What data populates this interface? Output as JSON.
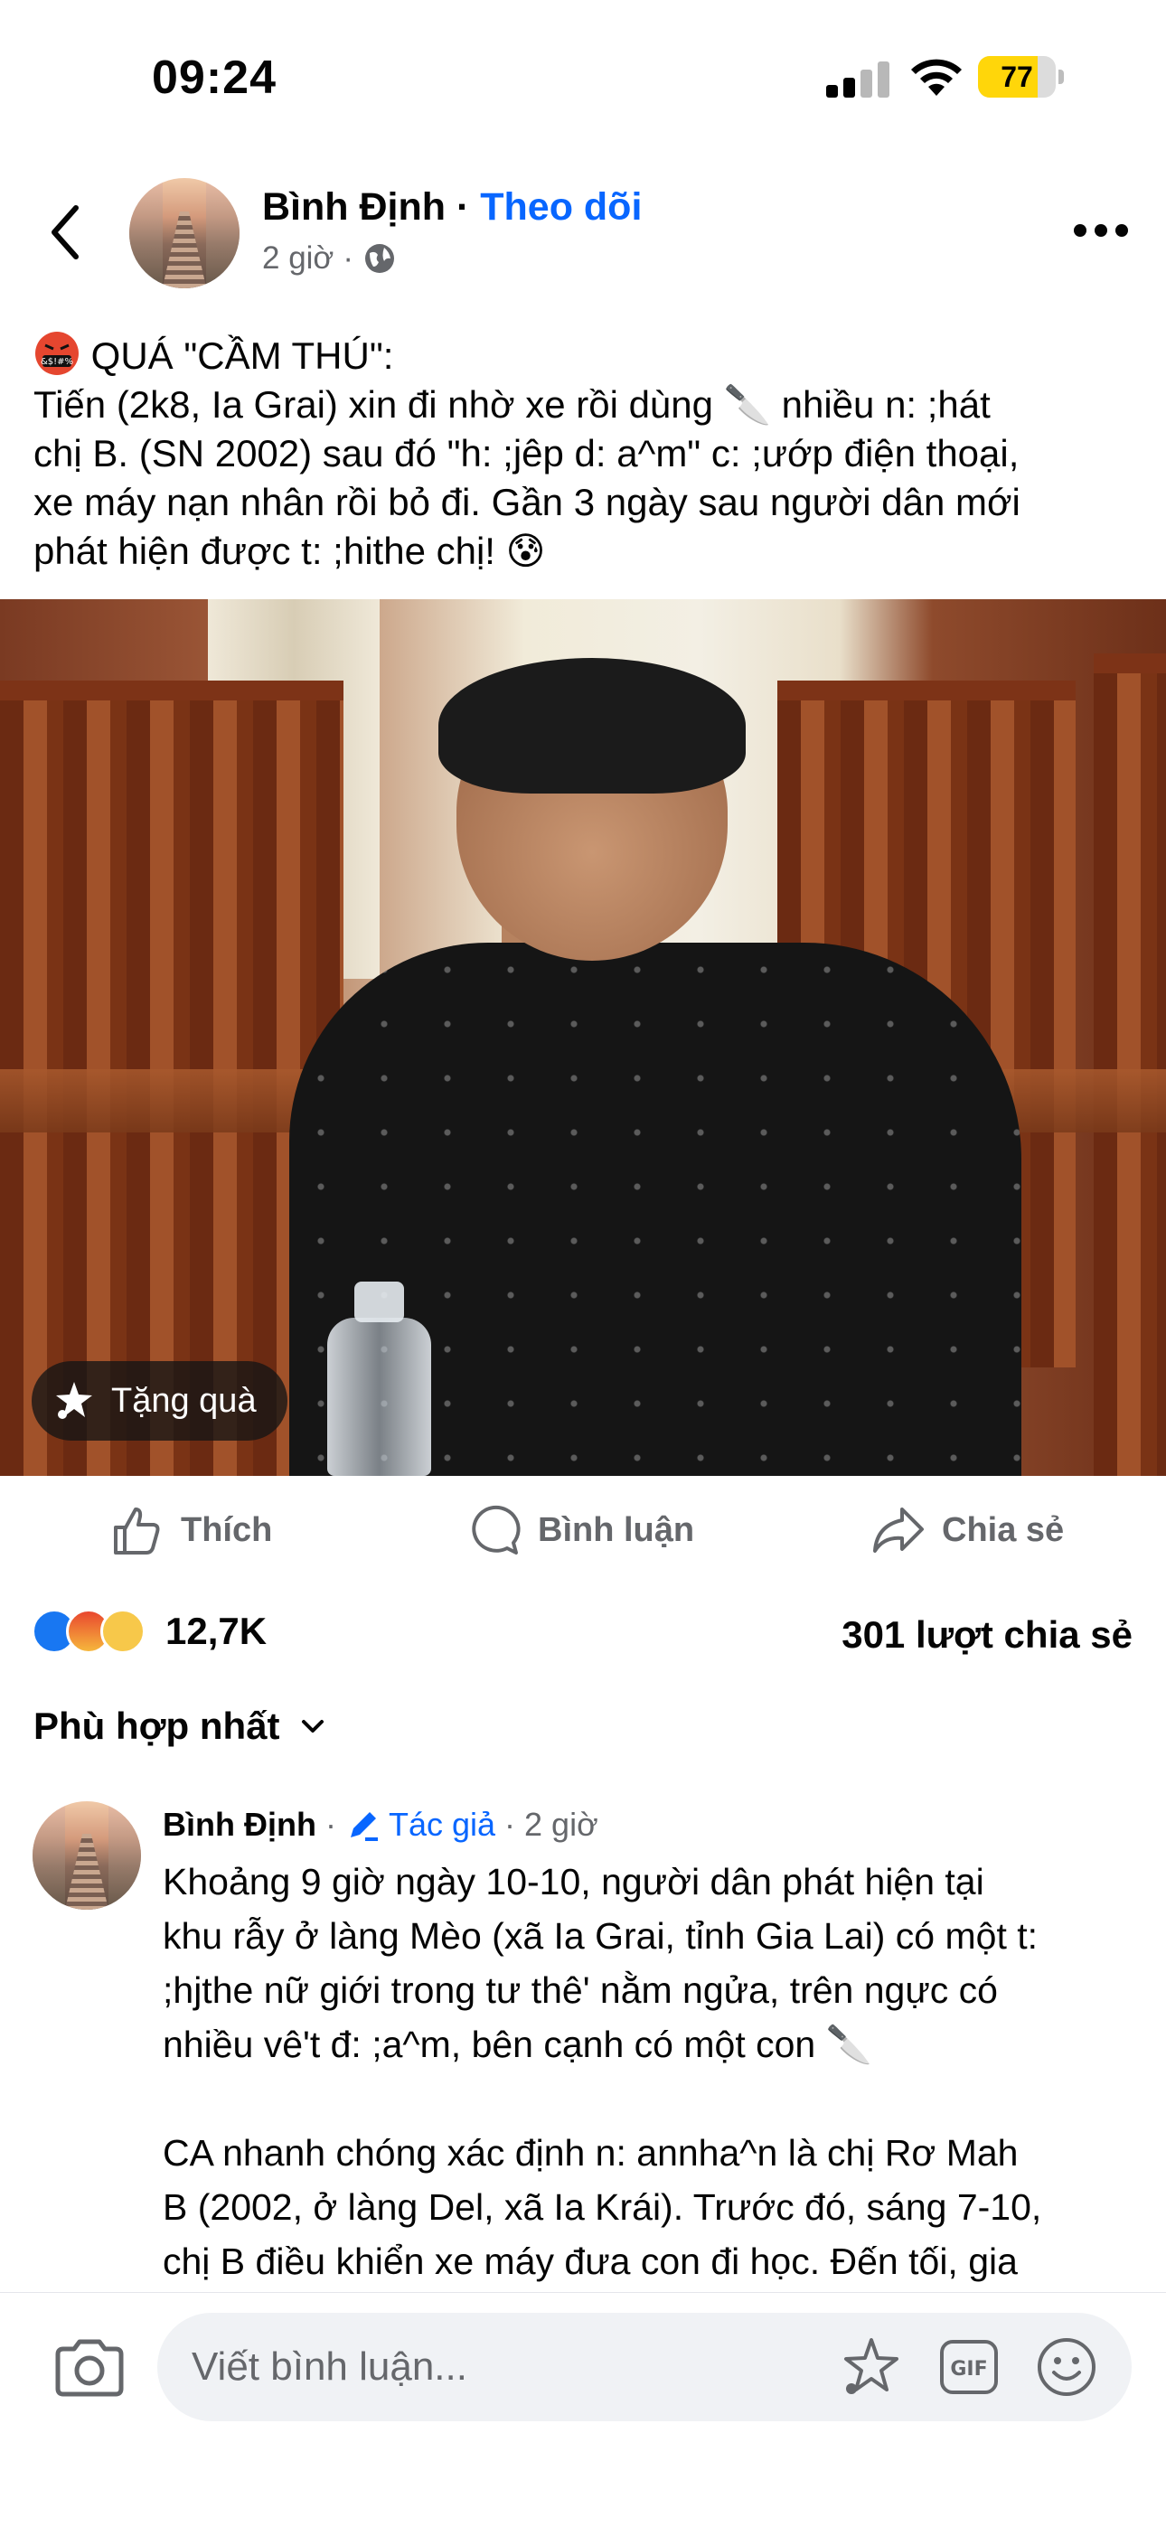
{
  "status_bar": {
    "time": "09:24",
    "battery": "77",
    "battery_level": 0.77,
    "battery_color": "#ffd60a"
  },
  "post": {
    "page_name": "Bình Định",
    "separator": "·",
    "follow_label": "Theo dõi",
    "time": "2 giờ",
    "meta_dot": "·",
    "audience_icon": "globe-icon",
    "caption_lines": [
      "QUÁ \"CẦM THÚ\":",
      "Tiến (2k8, Ia Grai) xin đi nhờ xe rồi dùng 🔪 nhiều n: ;hát",
      "chị B. (SN 2002) sau đó \"h: ;jêp d: a^m\" c: ;ướp điện thoại,",
      "xe máy nạn nhân rồi bỏ đi. Gần 3 ngày sau người dân mới",
      "phát hiện được t: ;hithe chị! 😰"
    ],
    "gift_label": "Tặng quà"
  },
  "actions": {
    "like_label": "Thích",
    "comment_label": "Bình luận",
    "share_label": "Chia sẻ"
  },
  "stats": {
    "reaction_count": "12,7K",
    "share_count": "301 lượt chia sẻ"
  },
  "sort": {
    "label": "Phù hợp nhất"
  },
  "comment": {
    "author": "Bình Định",
    "dot1": "·",
    "badge": "Tác giả",
    "dot2": "·",
    "time": "2 giờ",
    "paragraph1": [
      "Khoảng 9 giờ ngày 10-10, người dân phát hiện tại",
      "khu rẫy ở làng Mèo (xã Ia Grai, tỉnh Gia Lai) có một t:",
      ";hjthe nữ giới trong tư thê' nằm ngửa, trên ngực có",
      "nhiều vê't đ: ;a^m, bên cạnh có một con 🔪"
    ],
    "paragraph2": [
      "CA nhanh chóng xác định n: annha^n là chị Rơ Mah",
      "B (2002, ở làng Del, xã Ia Krái). Trước đó, sáng 7-10,",
      "chị B điều khiển xe máy đưa con đi học. Đến tối, gia"
    ]
  },
  "input_bar": {
    "placeholder": "Viết bình luận..."
  },
  "colors": {
    "accent": "#0866ff",
    "secondary_text": "#65676b",
    "input_bg": "#f0f2f5"
  }
}
